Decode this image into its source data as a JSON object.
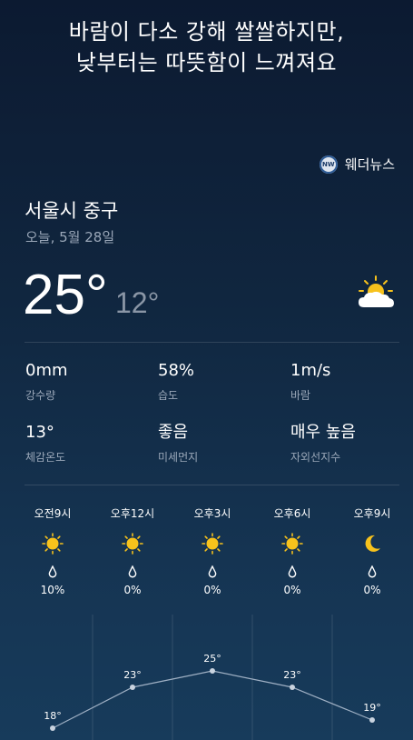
{
  "headline": {
    "line1": "바람이 다소 강해 쌀쌀하지만,",
    "line2": "낮부터는 따뜻함이 느껴져요"
  },
  "source": {
    "logo_text": "NW",
    "name": "웨더뉴스"
  },
  "location": {
    "name": "서울시 중구",
    "date": "오늘, 5월 28일"
  },
  "current": {
    "temp": "25°",
    "low": "12°",
    "icon": "partly-cloudy-icon"
  },
  "stats": [
    {
      "value": "0mm",
      "label": "강수량"
    },
    {
      "value": "58%",
      "label": "습도"
    },
    {
      "value": "1m/s",
      "label": "바람"
    },
    {
      "value": "13°",
      "label": "체감온도"
    },
    {
      "value": "좋음",
      "label": "미세먼지"
    },
    {
      "value": "매우 높음",
      "label": "자외선지수"
    }
  ],
  "hourly": [
    {
      "time": "오전9시",
      "icon": "sun-icon",
      "rain": "10%",
      "temp": "18°",
      "temp_value": 18
    },
    {
      "time": "오후12시",
      "icon": "sun-icon",
      "rain": "0%",
      "temp": "23°",
      "temp_value": 23
    },
    {
      "time": "오후3시",
      "icon": "sun-icon",
      "rain": "0%",
      "temp": "25°",
      "temp_value": 25
    },
    {
      "time": "오후6시",
      "icon": "sun-icon",
      "rain": "0%",
      "temp": "23°",
      "temp_value": 23
    },
    {
      "time": "오후9시",
      "icon": "moon-icon",
      "rain": "0%",
      "temp": "19°",
      "temp_value": 19
    }
  ],
  "colors": {
    "sun": "#f7c21c",
    "moon": "#f7c21c",
    "cloud": "#ffffff",
    "muted_text": "#9aa7b8",
    "graph_line": "#9fb0c4"
  }
}
